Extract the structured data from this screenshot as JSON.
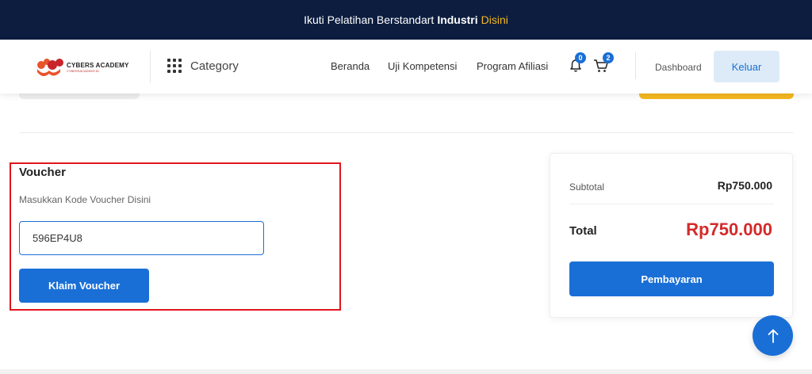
{
  "topbar": {
    "text_normal": "Ikuti Pelatihan Berstandart",
    "text_strong": "Industri",
    "text_accent": "Disini",
    "accent_color": "#f5b820",
    "background": "#0c1d3f"
  },
  "header": {
    "logo_text": "CYBERS ACADEMY",
    "logo_subtext": "CYBERSACADEMY.ID",
    "category_label": "Category",
    "nav": [
      {
        "label": "Beranda"
      },
      {
        "label": "Uji Kompetensi"
      },
      {
        "label": "Program Afiliasi"
      }
    ],
    "notification_count": "0",
    "cart_count": "2",
    "dashboard_label": "Dashboard",
    "logout_label": "Keluar"
  },
  "voucher": {
    "title": "Voucher",
    "hint": "Masukkan Kode Voucher Disini",
    "code_value": "596EP4U8",
    "claim_label": "Klaim Voucher"
  },
  "summary": {
    "subtotal_label": "Subtotal",
    "subtotal_value": "Rp750.000",
    "total_label": "Total",
    "total_value": "Rp750.000",
    "pay_label": "Pembayaran"
  },
  "colors": {
    "primary": "#1a6fd6",
    "total_red": "#d42a2a",
    "highlight_red": "#e0161e",
    "navy": "#0c1d3f"
  },
  "icons": {
    "category": "grid-icon",
    "notification": "bell-icon",
    "cart": "cart-icon",
    "scroll_top": "arrow-up-icon"
  }
}
